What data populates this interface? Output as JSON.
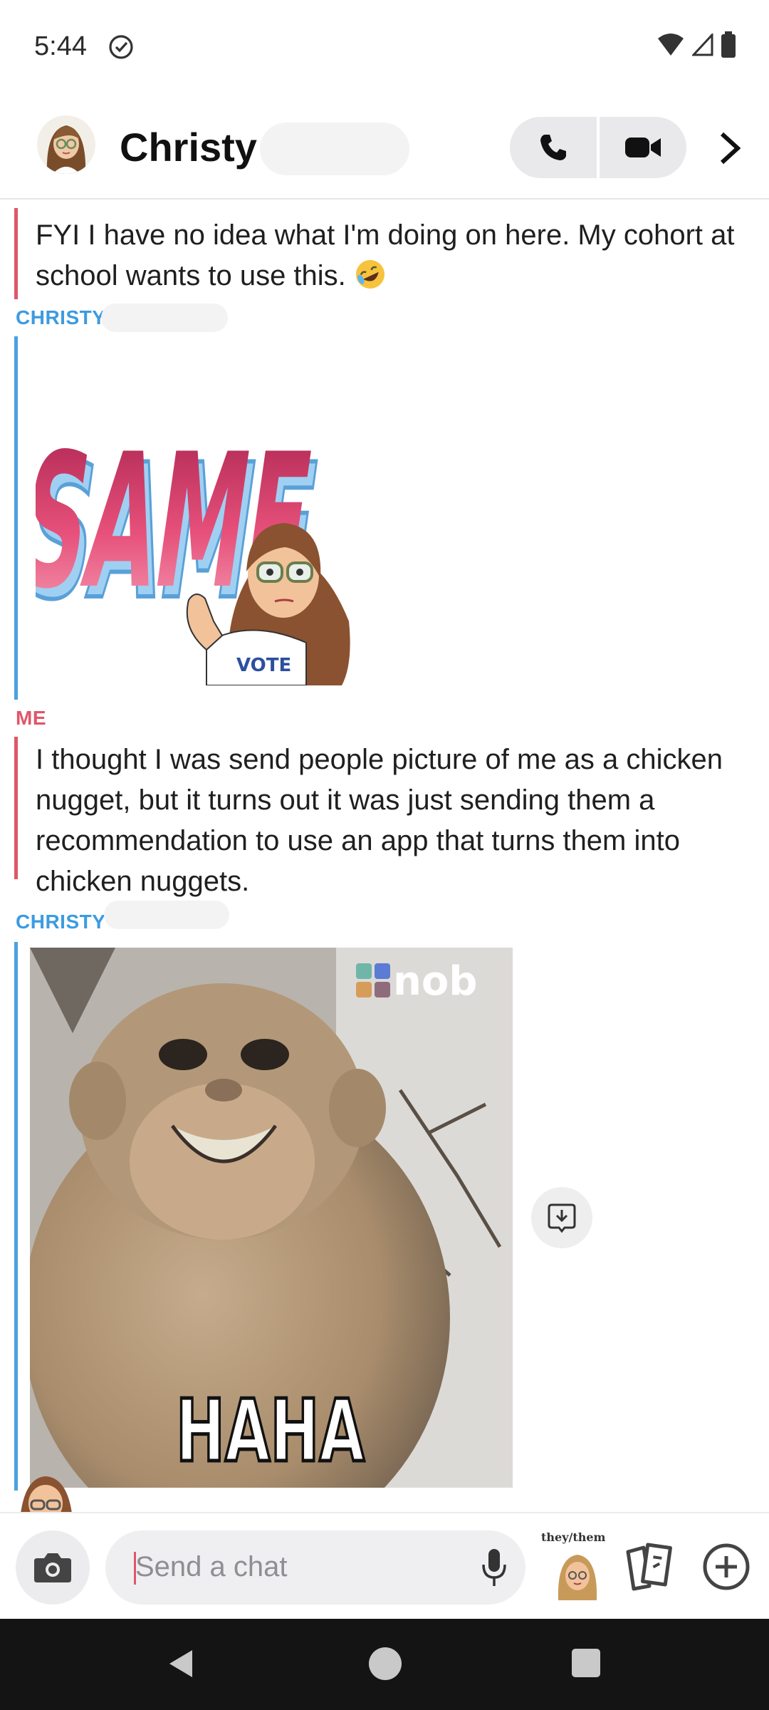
{
  "status_bar": {
    "time": "5:44"
  },
  "header": {
    "contact_name": "Christy"
  },
  "messages": [
    {
      "text": "FYI I have no idea what I'm doing on here. My cohort at school wants to use this."
    },
    {
      "sender": "CHRISTY",
      "sticker_text": "SAME",
      "sticker_badge": "VOTE"
    },
    {
      "sender": "ME",
      "text": "I thought I was send people picture of me as a chicken nugget, but it turns out it was just sending them a recommendation to use an app that turns them into chicken nuggets."
    },
    {
      "sender": "CHRISTY",
      "gif_caption": "HAHA",
      "gif_watermark": "nob"
    }
  ],
  "input_bar": {
    "placeholder": "Send a chat",
    "pronoun_label": "they/them"
  },
  "colors": {
    "me": "#e0566a",
    "friend": "#4aa2e0"
  }
}
